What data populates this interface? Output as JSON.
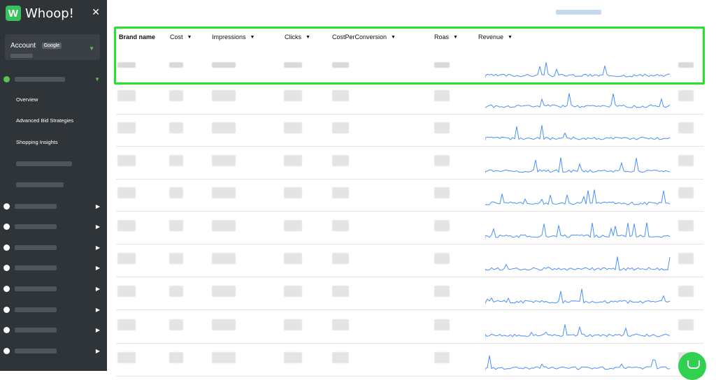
{
  "app": {
    "name": "Whoop!"
  },
  "account": {
    "label": "Account",
    "source_badge": "Google"
  },
  "sidebar": {
    "sub_items": [
      "Overview",
      "Advanced Bid Strategies",
      "Shopping Insights"
    ]
  },
  "table": {
    "headers": [
      "Brand name",
      "Cost",
      "Impressions",
      "Clicks",
      "CostPerConversion",
      "Roas",
      "Revenue"
    ]
  },
  "colors": {
    "accent": "#23e42a",
    "spark": "#4a90f7",
    "sidebar": "#2f3439"
  }
}
